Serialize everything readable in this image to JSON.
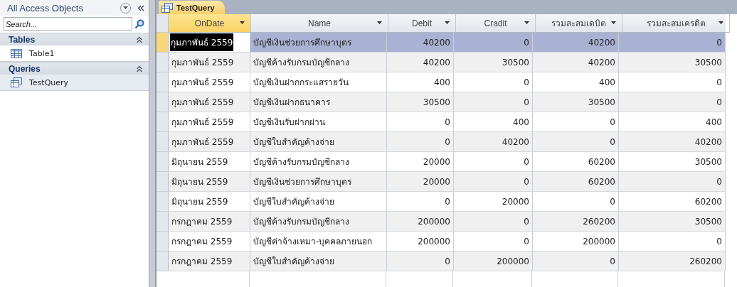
{
  "nav": {
    "title": "All Access Objects",
    "search": {
      "placeholder": "Search..."
    },
    "groups": [
      {
        "label": "Tables",
        "items": [
          {
            "label": "Table1",
            "kind": "table",
            "selected": false
          }
        ]
      },
      {
        "label": "Queries",
        "items": [
          {
            "label": "TestQuery",
            "kind": "query",
            "selected": true
          }
        ]
      }
    ]
  },
  "tab": {
    "title": "TestQuery"
  },
  "columns": [
    {
      "label": "OnDate",
      "kind": "text",
      "selected": true
    },
    {
      "label": "Name",
      "kind": "text",
      "selected": false
    },
    {
      "label": "Debit",
      "kind": "number",
      "selected": false
    },
    {
      "label": "Cradit",
      "kind": "number",
      "selected": false
    },
    {
      "label": "รวมสะสมเดบิต",
      "kind": "number",
      "selected": false
    },
    {
      "label": "รวมสะสมเครดิต",
      "kind": "number",
      "selected": false
    }
  ],
  "rows": [
    {
      "selected": true,
      "cells": [
        "กุมภาพันธ์ 2559",
        "บัญชีเงินช่วยการศึกษาบุตร",
        "40200",
        "0",
        "40200",
        "0"
      ]
    },
    {
      "selected": false,
      "cells": [
        "กุมภาพันธ์ 2559",
        "บัญชีค้างรับกรมบัญชีกลาง",
        "40200",
        "30500",
        "40200",
        "30500"
      ]
    },
    {
      "selected": false,
      "cells": [
        "กุมภาพันธ์ 2559",
        "บัญชีเงินฝากกระแสรายวัน",
        "400",
        "0",
        "400",
        "0"
      ]
    },
    {
      "selected": false,
      "cells": [
        "กุมภาพันธ์ 2559",
        "บัญชีเงินฝากธนาคาร",
        "30500",
        "0",
        "30500",
        "0"
      ]
    },
    {
      "selected": false,
      "cells": [
        "กุมภาพันธ์ 2559",
        "บัญชีเงินรับฝากผ่าน",
        "0",
        "400",
        "0",
        "400"
      ]
    },
    {
      "selected": false,
      "cells": [
        "กุมภาพันธ์ 2559",
        "บัญชีใบสำคัญค้างจ่าย",
        "0",
        "40200",
        "0",
        "40200"
      ]
    },
    {
      "selected": false,
      "cells": [
        "มิถุนายน 2559",
        "บัญชีค้างรับกรมบัญชีกลาง",
        "20000",
        "0",
        "60200",
        "30500"
      ]
    },
    {
      "selected": false,
      "cells": [
        "มิถุนายน 2559",
        "บัญชีเงินช่วยการศึกษาบุตร",
        "20000",
        "0",
        "60200",
        "0"
      ]
    },
    {
      "selected": false,
      "cells": [
        "มิถุนายน 2559",
        "บัญชีใบสำคัญค้างจ่าย",
        "0",
        "20000",
        "0",
        "60200"
      ]
    },
    {
      "selected": false,
      "cells": [
        "กรกฎาคม 2559",
        "บัญชีค้างรับกรมบัญชีกลาง",
        "200000",
        "0",
        "260200",
        "30500"
      ]
    },
    {
      "selected": false,
      "cells": [
        "กรกฎาคม 2559",
        "บัญชีค่าจ้างเหมา-บุคคลภายนอก",
        "200000",
        "0",
        "200000",
        "0"
      ]
    },
    {
      "selected": false,
      "cells": [
        "กรกฎาคม 2559",
        "บัญชีใบสำคัญค้างจ่าย",
        "0",
        "200000",
        "0",
        "260200"
      ]
    }
  ]
}
